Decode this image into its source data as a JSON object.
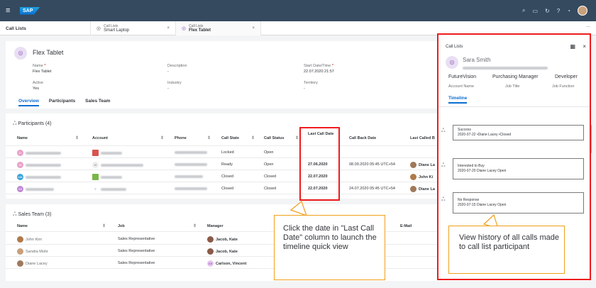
{
  "shell": {
    "logo": "SAP",
    "menu_icon": "menu-icon"
  },
  "tabs": {
    "main": "Call Lists",
    "tab1": {
      "small": "Call Lists",
      "label": "Smart Laptop"
    },
    "tab2": {
      "small": "Call Lists",
      "label": "Flex Tablet"
    },
    "close": "×",
    "more": "..."
  },
  "header": {
    "title": "Flex Tablet",
    "name_label": "Name",
    "name_value": "Flex Tablet",
    "desc_label": "Description",
    "desc_value": "-",
    "start_label": "Start Date/Time",
    "start_value": "22.07.2020 21:57",
    "active_label": "Active",
    "active_value": "Yes",
    "industry_label": "Industry",
    "industry_value": "-",
    "territory_label": "Territory",
    "territory_value": "-",
    "subtabs": [
      "Overview",
      "Participants",
      "Sales Team"
    ]
  },
  "participants": {
    "title": "Participants (4)",
    "columns": [
      "Name",
      "Account",
      "Phone",
      "Call State",
      "Call Status",
      "Last Call Date",
      "Call Back Date",
      "Last Called B"
    ],
    "rows": [
      {
        "init": "JV",
        "state": "Locked",
        "status": "Open",
        "last": "",
        "callback": "",
        "by": ""
      },
      {
        "init": "JR",
        "state": "Ready",
        "status": "Open",
        "last": "27.06.2020",
        "callback": "08.09.2020 05:45 UTC+54",
        "by": "Diane La"
      },
      {
        "init": "MB",
        "state": "Closed",
        "status": "Closed",
        "last": "22.07.2020",
        "callback": "",
        "by": "John Ki"
      },
      {
        "init": "SS",
        "state": "Closed",
        "status": "Closed",
        "last": "22.07.2020",
        "callback": "24.07.2020 05:45 UTC+54",
        "by": "Diane La"
      }
    ]
  },
  "sales_team": {
    "title": "Sales Team (3)",
    "columns": [
      "Name",
      "Job",
      "Manager",
      "E-Mail"
    ],
    "rows": [
      {
        "name": "John Kim",
        "job": "Sales Representative",
        "manager": "Jacob, Kate"
      },
      {
        "name": "Sandra Mohr",
        "job": "Sales Representative",
        "manager": "Jacob, Kate"
      },
      {
        "name": "Diane Lacey",
        "job": "Sales Representative",
        "manager": "Carlson, Vincent",
        "manager_init": "CV"
      }
    ]
  },
  "panel": {
    "header": "Call Lists",
    "person": "Sara Smith",
    "facts": [
      {
        "value": "FutureVision",
        "label": "Account Name"
      },
      {
        "value": "Purchasing Manager",
        "label": "Job Title"
      },
      {
        "value": "Developer",
        "label": "Job Function"
      }
    ],
    "tab": "Timeline",
    "timeline": [
      {
        "title": "Success",
        "detail": "2020-07-22 •Diane Lacey •Closed"
      },
      {
        "title": "Interested to Buy",
        "detail": "2020-07-20 Diane Lacey Open"
      },
      {
        "title": "No Response",
        "detail": "2020-07-15 Diane Lacey Open"
      }
    ]
  },
  "callouts": {
    "left": "Click the date in \"Last Call Date\" column to launch the timeline quick view",
    "right": "View history of all calls made to call list participant"
  },
  "colors": {
    "shell": "#354a5f",
    "accent": "#0a6ed1",
    "highlight": "#ee1c1c",
    "callout_border": "#f0a01a"
  }
}
